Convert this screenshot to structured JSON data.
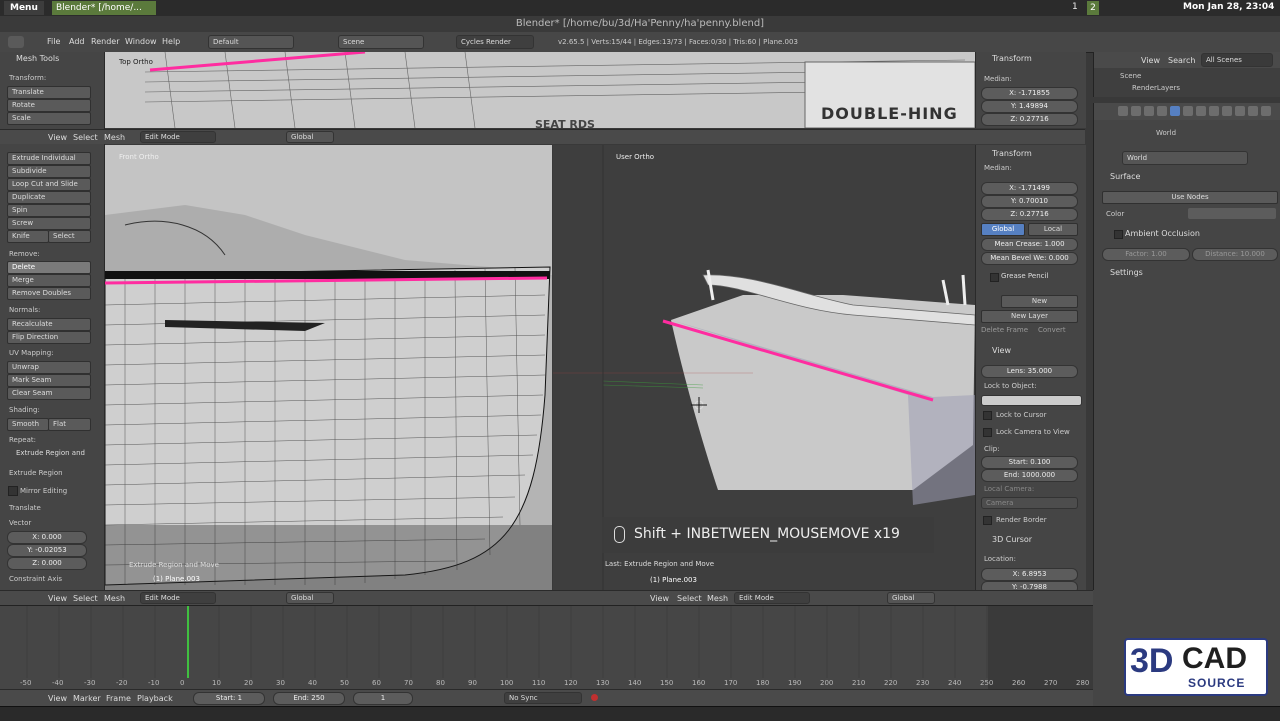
{
  "taskbar": {
    "menu_label": "Menu",
    "task_label": "Blender* [/home/...",
    "workspace_numbers": [
      "1",
      "2"
    ],
    "clock": "Mon Jan 28, 23:04"
  },
  "window_title": "Blender* [/home/bu/3d/Ha'Penny/ha'penny.blend]",
  "info_header": {
    "menus": [
      "File",
      "Add",
      "Render",
      "Window",
      "Help"
    ],
    "layout": "Default",
    "scene": "Scene",
    "engine": "Cycles Render",
    "stats": "v2.65.5 | Verts:15/44 | Edges:13/73 | Faces:0/30 | Tris:60 | Plane.003"
  },
  "tool_shelf": {
    "title": "Mesh Tools",
    "transform_header": "Transform:",
    "transform": [
      "Translate",
      "Rotate",
      "Scale"
    ],
    "deform": [
      "Extrude Individual",
      "Subdivide",
      "Loop Cut and Slide",
      "Duplicate",
      "Spin",
      "Screw"
    ],
    "knife": "Knife",
    "select": "Select",
    "remove_header": "Remove:",
    "remove": [
      "Delete",
      "Merge",
      "Remove Doubles"
    ],
    "normals_header": "Normals:",
    "normals": [
      "Recalculate",
      "Flip Direction"
    ],
    "uv_header": "UV Mapping:",
    "uv": [
      "Unwrap",
      "Mark Seam",
      "Clear Seam"
    ],
    "shading_header": "Shading:",
    "smooth": "Smooth",
    "flat": "Flat",
    "repeat_header": "Repeat:",
    "repeat_item": "Extrude Region and",
    "op_title": "Extrude Region and Move",
    "op_sub": "Extrude Region",
    "mirror_editing": "Mirror Editing",
    "translate": "Translate",
    "vector_header": "Vector",
    "vector": [
      "X: 0.000",
      "Y: -0.02053",
      "Z: 0.000"
    ],
    "constraint_axis": "Constraint Axis"
  },
  "viewports": {
    "top_label": "Top Ortho",
    "front_label": "Front Ortho",
    "user_label": "User Ortho",
    "front_op": "Extrude Region and Move",
    "front_obj": "(1) Plane.003",
    "user_op": "Last: Extrude Region and Move",
    "user_obj": "(1) Plane.003",
    "key_overlay": "Shift + INBETWEEN_MOUSEMOVE x19",
    "top_sign": "DOUBLE-HING",
    "top_sign2": "SEAT RDS"
  },
  "view_header": {
    "menus": [
      "View",
      "Select",
      "Mesh"
    ],
    "mode": "Edit Mode",
    "orientation": "Global"
  },
  "n_panel_top": {
    "transform": "Transform",
    "median": "Median:",
    "x": "X: -1.71855",
    "y": "Y: 1.49894",
    "z": "Z: 0.27716"
  },
  "n_panel": {
    "transform": "Transform",
    "median": "Median:",
    "x": "X: -1.71499",
    "y": "Y: 0.70010",
    "z": "Z: 0.27716",
    "global": "Global",
    "local": "Local",
    "mean_crease": "Mean Crease: 1.000",
    "mean_bevel": "Mean Bevel We: 0.000",
    "grease_pencil": "Grease Pencil",
    "new": "New",
    "new_layer": "New Layer",
    "delete_frame": "Delete Frame",
    "convert": "Convert",
    "view": "View",
    "lens": "Lens: 35.000",
    "lock_to_object": "Lock to Object:",
    "lock_to_cursor": "Lock to Cursor",
    "lock_camera": "Lock Camera to View",
    "clip": "Clip:",
    "clip_start": "Start: 0.100",
    "clip_end": "End: 1000.000",
    "local_camera": "Local Camera:",
    "camera": "Camera",
    "render_border": "Render Border",
    "cursor": "3D Cursor",
    "location": "Location:",
    "cx": "X: 6.8953",
    "cy": "Y: -0.7988"
  },
  "outliner": {
    "menus": [
      "View",
      "Search"
    ],
    "filter": "All Scenes",
    "scene": "Scene",
    "render_layers": "RenderLayers"
  },
  "properties": {
    "world_crumb": "World",
    "world_field": "World",
    "surface": "Surface",
    "use_nodes": "Use Nodes",
    "color": "Color",
    "ambient": "Ambient Occlusion",
    "factor": "Factor: 1.00",
    "distance": "Distance: 10.000",
    "settings": "Settings"
  },
  "timeline": {
    "ticks": [
      "-50",
      "-40",
      "-30",
      "-20",
      "-10",
      "0",
      "10",
      "20",
      "30",
      "40",
      "50",
      "60",
      "70",
      "80",
      "90",
      "100",
      "110",
      "120",
      "130",
      "140",
      "150",
      "160",
      "170",
      "180",
      "190",
      "200",
      "210",
      "220",
      "230",
      "240",
      "250",
      "260",
      "270",
      "280"
    ],
    "menus": [
      "View",
      "Marker",
      "Frame",
      "Playback"
    ],
    "start": "Start: 1",
    "end": "End: 250",
    "current": "1",
    "sync": "No Sync",
    "current_frame": 1
  },
  "logo": {
    "text_3d": "3D",
    "text_cad": "CAD",
    "text_source": "SOURCE"
  },
  "colors": {
    "selection_pink": "#ff2ca0",
    "accent_blue": "#5680c2",
    "playhead_green": "#40c040"
  }
}
